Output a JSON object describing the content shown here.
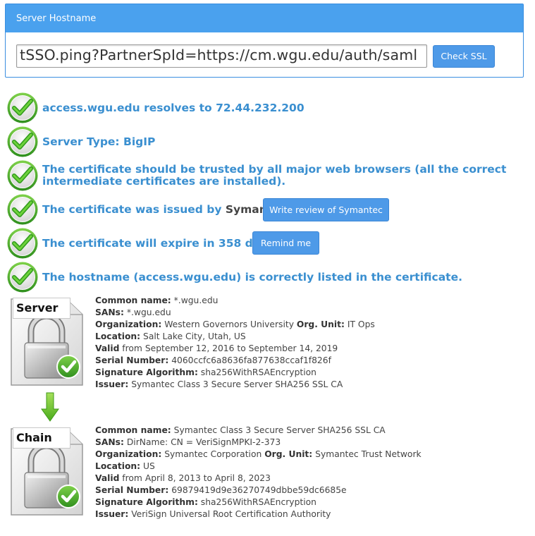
{
  "panel": {
    "title": "Server Hostname",
    "hostname_value": "tSSO.ping?PartnerSpId=https://cm.wgu.edu/auth/saml",
    "check_button": "Check SSL"
  },
  "results": [
    {
      "text": "access.wgu.edu resolves to 72.44.232.200"
    },
    {
      "text": "Server Type: BigIP"
    },
    {
      "text": "The certificate should be trusted by all major web browsers (all the correct intermediate certificates are installed)."
    },
    {
      "text_prefix": "The certificate was issued by ",
      "text_dark": "Symantec",
      "text_suffix": ".",
      "button": "Write review of Symantec"
    },
    {
      "text": "The certificate will expire in 358 days.",
      "button": "Remind me"
    },
    {
      "text": "The hostname (access.wgu.edu) is correctly listed in the certificate."
    }
  ],
  "certs": [
    {
      "badge": "Server",
      "common_name_label": "Common name:",
      "common_name": "*.wgu.edu",
      "sans_label": "SANs:",
      "sans": "*.wgu.edu",
      "org_label": "Organization:",
      "org": "Western Governors University",
      "org_unit_label": "Org. Unit:",
      "org_unit": "IT Ops",
      "location_label": "Location:",
      "location": "Salt Lake City, Utah, US",
      "valid_label": "Valid",
      "valid": "from September 12, 2016 to September 14, 2019",
      "serial_label": "Serial Number:",
      "serial": "4060ccfc6a8636fa877638ccaf1f826f",
      "sig_label": "Signature Algorithm:",
      "sig": "sha256WithRSAEncryption",
      "issuer_label": "Issuer:",
      "issuer": "Symantec Class 3 Secure Server SHA256 SSL CA"
    },
    {
      "badge": "Chain",
      "common_name_label": "Common name:",
      "common_name": "Symantec Class 3 Secure Server SHA256 SSL CA",
      "sans_label": "SANs:",
      "sans": "DirName: CN = VeriSignMPKI-2-373",
      "org_label": "Organization:",
      "org": "Symantec Corporation",
      "org_unit_label": "Org. Unit:",
      "org_unit": "Symantec Trust Network",
      "location_label": "Location:",
      "location": "US",
      "valid_label": "Valid",
      "valid": "from April 8, 2013 to April 8, 2023",
      "serial_label": "Serial Number:",
      "serial": "69879419d9e36270749dbbe59dc6685e",
      "sig_label": "Signature Algorithm:",
      "sig": "sha256WithRSAEncryption",
      "issuer_label": "Issuer:",
      "issuer": "VeriSign Universal Root Certification Authority"
    }
  ],
  "colors": {
    "accent": "#4aa1ee",
    "result_text": "#3a8fd0",
    "check_green": "#4cae2e",
    "arrow_green": "#6cc32e"
  }
}
